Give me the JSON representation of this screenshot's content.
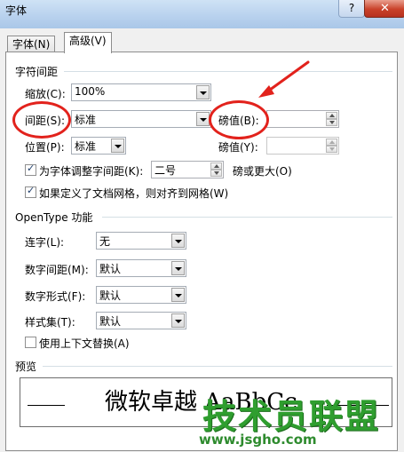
{
  "window": {
    "title": "字体",
    "help_label": "?",
    "close_label": "✕"
  },
  "tabs": [
    {
      "label": "字体(N)",
      "active": false
    },
    {
      "label": "高级(V)",
      "active": true
    }
  ],
  "char_spacing": {
    "group_title": "字符间距",
    "scale": {
      "label": "缩放(C):",
      "value": "100%"
    },
    "spacing": {
      "label": "间距(S):",
      "value": "标准"
    },
    "spacing_by": {
      "label": "磅值(B):",
      "value": ""
    },
    "position": {
      "label": "位置(P):",
      "value": "标准"
    },
    "position_by": {
      "label": "磅值(Y):",
      "value": ""
    },
    "kerning": {
      "label": "为字体调整字间距(K):",
      "checked": true,
      "value": "二号",
      "suffix": "磅或更大(O)"
    },
    "snap_grid": {
      "label": "如果定义了文档网格，则对齐到网格(W)",
      "checked": true
    }
  },
  "opentype": {
    "group_title": "OpenType 功能",
    "ligatures": {
      "label": "连字(L):",
      "value": "无"
    },
    "number_spacing": {
      "label": "数字间距(M):",
      "value": "默认"
    },
    "number_forms": {
      "label": "数字形式(F):",
      "value": "默认"
    },
    "stylistic_sets": {
      "label": "样式集(T):",
      "value": "默认"
    },
    "contextual_alternates": {
      "label": "使用上下文替换(A)",
      "checked": false
    }
  },
  "preview": {
    "group_title": "预览",
    "text": "微软卓越 AaBbCc"
  },
  "watermark": {
    "text": "技术员联盟",
    "url": "www.jsgho.com"
  },
  "annotation": {
    "color": "#e2221c"
  }
}
